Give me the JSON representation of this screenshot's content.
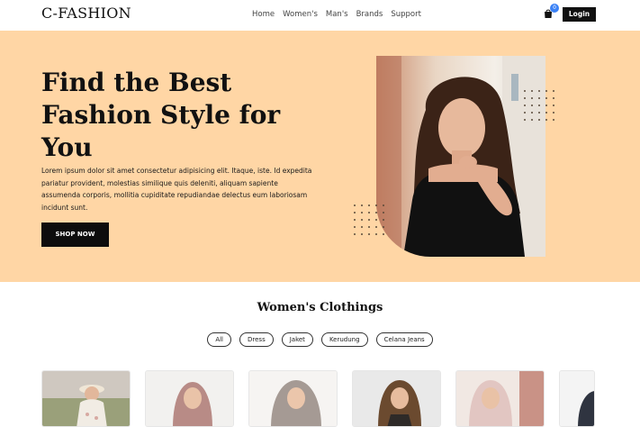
{
  "header": {
    "logo": "C-FASHION",
    "nav": [
      "Home",
      "Women's",
      "Man's",
      "Brands",
      "Support"
    ],
    "cart_count": "0",
    "login_label": "Login"
  },
  "hero": {
    "title": "Find the Best Fashion Style for You",
    "description": "Lorem ipsum dolor sit amet consectetur adipisicing elit. Itaque, iste. Id expedita pariatur provident, molestias similique quis deleniti, aliquam sapiente assumenda corporis, mollitia cupiditate repudiandae delectus eum laboriosam incidunt sunt.",
    "cta_label": "SHOP NOW",
    "background_color": "#ffd6a5"
  },
  "section": {
    "title": "Women's Clothings",
    "filters": [
      "All",
      "Dress",
      "Jaket",
      "Kerudung",
      "Celana Jeans"
    ]
  },
  "colors": {
    "accent_dark": "#111111",
    "badge": "#3b82f6"
  }
}
